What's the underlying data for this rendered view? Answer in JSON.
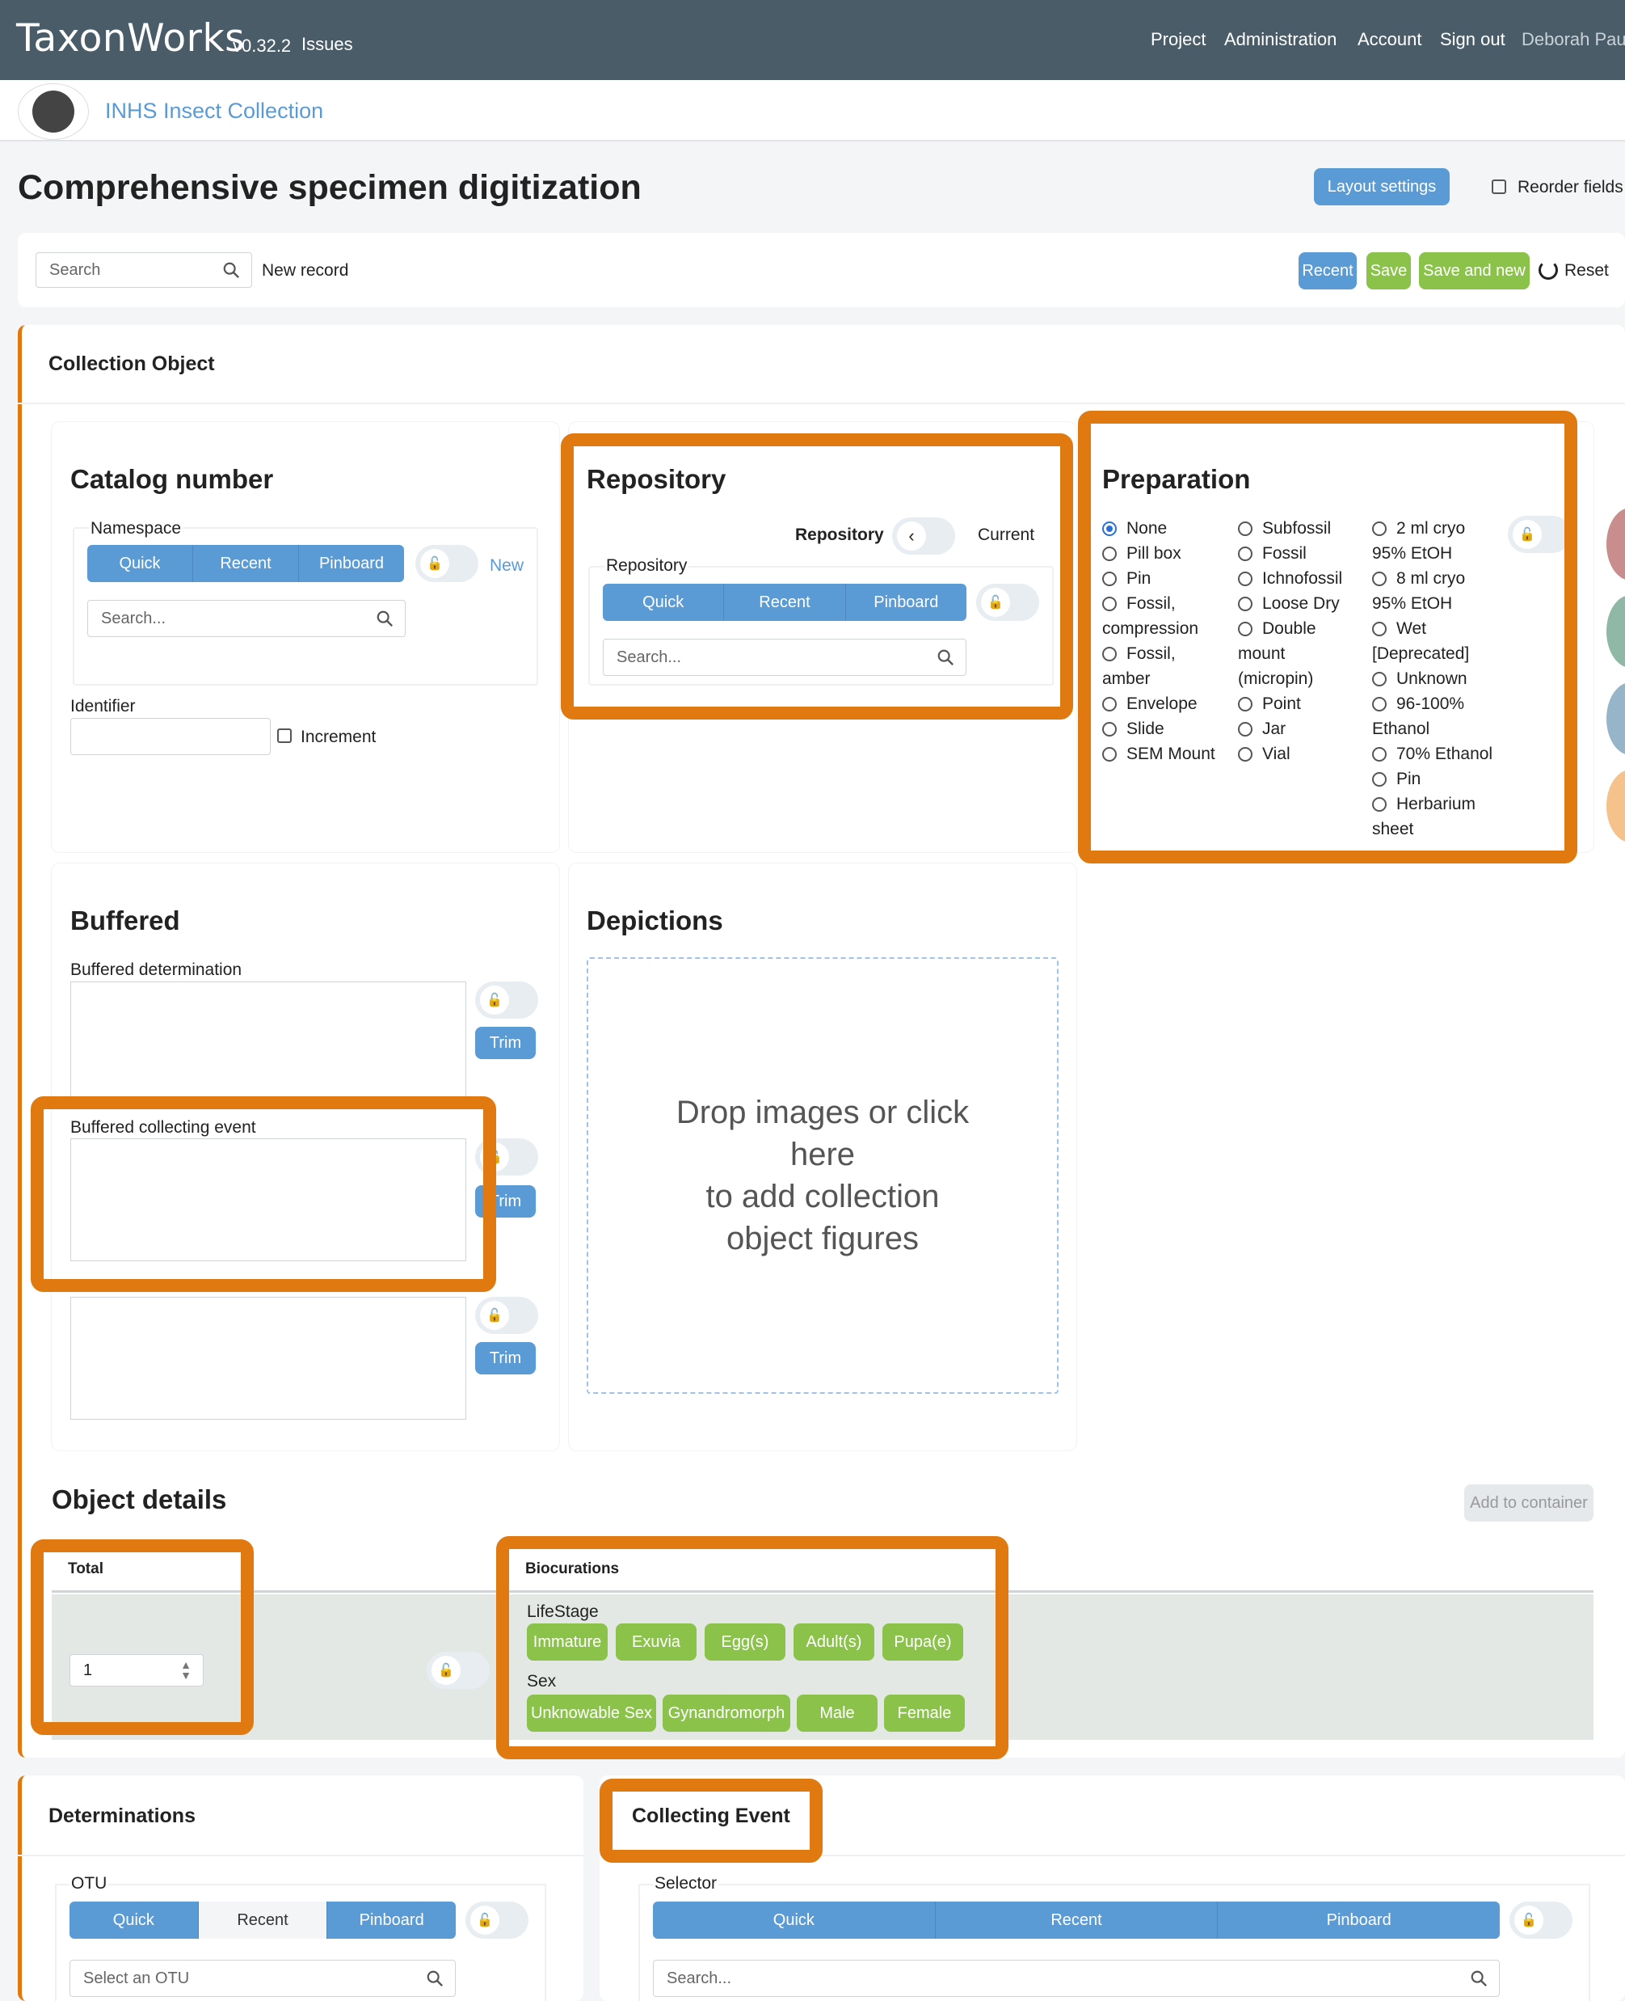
{
  "header": {
    "brand": "TaxonWorks",
    "version": "v0.32.2",
    "issues": "Issues",
    "nav": [
      "Project",
      "Administration",
      "Account",
      "Sign out",
      "Deborah Paul"
    ],
    "project_name": "INHS Insect Collection"
  },
  "page": {
    "title": "Comprehensive specimen digitization",
    "layout_settings": "Layout settings",
    "reorder_fields": "Reorder fields"
  },
  "toolbar": {
    "search_placeholder": "Search",
    "new_record": "New record",
    "recent": "Recent",
    "save": "Save",
    "save_and_new": "Save and new",
    "reset": "Reset"
  },
  "collection_object": {
    "section_title": "Collection Object",
    "catalog": {
      "title": "Catalog number",
      "namespace_label": "Namespace",
      "tabs": [
        "Quick",
        "Recent",
        "Pinboard"
      ],
      "new_link": "New",
      "search_placeholder": "Search...",
      "identifier_label": "Identifier",
      "increment_label": "Increment"
    },
    "repository": {
      "title": "Repository",
      "toggle_left": "Repository",
      "toggle_right": "Current",
      "field_label": "Repository",
      "tabs": [
        "Quick",
        "Recent",
        "Pinboard"
      ],
      "search_placeholder": "Search..."
    },
    "preparation": {
      "title": "Preparation",
      "col1": [
        "None",
        "Pill box",
        "Pin",
        "Fossil,",
        "compression",
        "Fossil,",
        "amber",
        "Envelope",
        "Slide",
        "SEM Mount"
      ],
      "col2": [
        "Subfossil",
        "Fossil",
        "Ichnofossil",
        "Loose Dry",
        "Double",
        "mount",
        "(micropin)",
        "Point",
        "Jar",
        "Vial"
      ],
      "col3": [
        "2 ml cryo",
        "95% EtOH",
        "8 ml cryo",
        "95% EtOH",
        "Wet",
        "[Deprecated]",
        "Unknown",
        "96-100%",
        "Ethanol",
        "70% Ethanol",
        "Pin",
        "Herbarium",
        "sheet"
      ]
    },
    "buffered": {
      "title": "Buffered",
      "determination_label": "Buffered determination",
      "collecting_event_label": "Buffered collecting event",
      "trim": "Trim"
    },
    "depictions": {
      "title": "Depictions",
      "drop_text": [
        "Drop images or click",
        "here",
        "to add collection",
        "object figures"
      ]
    }
  },
  "object_details": {
    "title": "Object details",
    "add_to_container": "Add to container",
    "total_header": "Total",
    "total_value": "1",
    "biocurations_header": "Biocurations",
    "lifestage_label": "LifeStage",
    "lifestage": [
      "Immature",
      "Exuvia",
      "Egg(s)",
      "Adult(s)",
      "Pupa(e)"
    ],
    "sex_label": "Sex",
    "sex": [
      "Unknowable Sex",
      "Gynandromorph",
      "Male",
      "Female"
    ]
  },
  "determinations": {
    "title": "Determinations",
    "otu_label": "OTU",
    "tabs": [
      "Quick",
      "Recent",
      "Pinboard"
    ],
    "placeholder": "Select an OTU"
  },
  "collecting_event": {
    "title": "Collecting Event",
    "selector_label": "Selector",
    "tabs": [
      "Quick",
      "Recent",
      "Pinboard"
    ],
    "placeholder": "Search..."
  },
  "colors": {
    "header_bg": "#4a5c68",
    "blue": "#5b9bd5",
    "green": "#8bc34a",
    "highlight": "#e07a10"
  }
}
